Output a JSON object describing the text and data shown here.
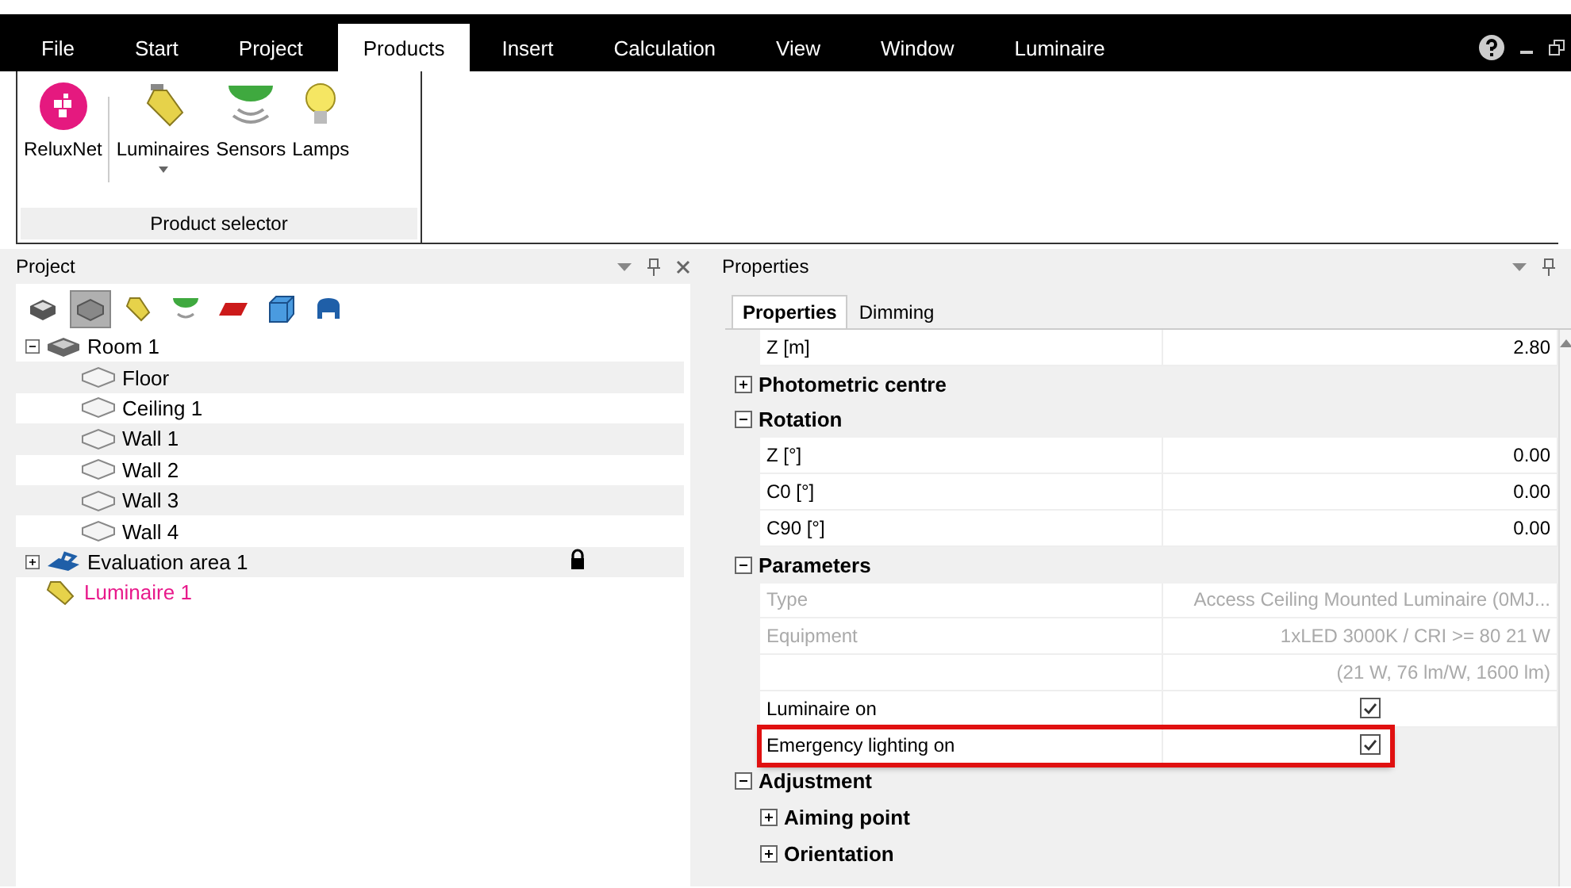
{
  "menu": [
    {
      "label": "File",
      "selected": false
    },
    {
      "label": "Start",
      "selected": false
    },
    {
      "label": "Project",
      "selected": false
    },
    {
      "label": "Products",
      "selected": true
    },
    {
      "label": "Insert",
      "selected": false
    },
    {
      "label": "Calculation",
      "selected": false
    },
    {
      "label": "View",
      "selected": false
    },
    {
      "label": "Window",
      "selected": false
    },
    {
      "label": "Luminaire",
      "selected": false
    }
  ],
  "ribbon": {
    "groups": [
      {
        "items": [
          {
            "kind": "reluxnet",
            "label": "ReluxNet",
            "dropdown": false
          }
        ]
      },
      {
        "items": [
          {
            "kind": "luminaire",
            "label": "Luminaires",
            "dropdown": true
          },
          {
            "kind": "sensor",
            "label": "Sensors",
            "dropdown": false
          },
          {
            "kind": "lamp",
            "label": "Lamps",
            "dropdown": false
          }
        ]
      }
    ],
    "group_label": "Product selector"
  },
  "project": {
    "title": "Project",
    "toolbar": [
      {
        "kind": "solid",
        "selected": false
      },
      {
        "kind": "wire",
        "selected": true
      },
      {
        "kind": "luminaire",
        "selected": false
      },
      {
        "kind": "sensor",
        "selected": false
      },
      {
        "kind": "plane",
        "selected": false
      },
      {
        "kind": "cube",
        "selected": false
      },
      {
        "kind": "chair",
        "selected": false
      }
    ],
    "tree": [
      {
        "label": "Room 1",
        "kind": "room",
        "expanded": true,
        "locked": false,
        "color": "#000000",
        "children": [
          {
            "label": "Floor",
            "kind": "surface",
            "locked": false,
            "color": "#000000"
          },
          {
            "label": "Ceiling 1",
            "kind": "surface",
            "locked": false,
            "color": "#000000"
          },
          {
            "label": "Wall 1",
            "kind": "surface",
            "locked": false,
            "color": "#000000"
          },
          {
            "label": "Wall 2",
            "kind": "surface",
            "locked": false,
            "color": "#000000"
          },
          {
            "label": "Wall 3",
            "kind": "surface",
            "locked": false,
            "color": "#000000"
          },
          {
            "label": "Wall 4",
            "kind": "surface",
            "locked": false,
            "color": "#000000"
          }
        ]
      },
      {
        "label": "Evaluation area 1",
        "kind": "evaluation",
        "expanded": false,
        "locked": true,
        "color": "#000000"
      },
      {
        "label": "Luminaire 1",
        "kind": "luminaire",
        "locked": false,
        "color": "#e8198b"
      }
    ]
  },
  "properties": {
    "title": "Properties",
    "tabs": [
      {
        "label": "Properties",
        "selected": true
      },
      {
        "label": "Dimming",
        "selected": false
      }
    ],
    "items": [
      {
        "kind": "row",
        "label": "Z [m]",
        "value": "2.80",
        "disabled": false
      },
      {
        "kind": "category",
        "label": "Photometric centre",
        "expanded": false
      },
      {
        "kind": "category",
        "label": "Rotation",
        "expanded": true,
        "children": [
          {
            "kind": "row",
            "label": "Z [°]",
            "value": "0.00",
            "disabled": false
          },
          {
            "kind": "row",
            "label": "C0 [°]",
            "value": "0.00",
            "disabled": false
          },
          {
            "kind": "row",
            "label": "C90 [°]",
            "value": "0.00",
            "disabled": false
          }
        ]
      },
      {
        "kind": "category",
        "label": "Parameters",
        "expanded": true,
        "children": [
          {
            "kind": "row",
            "label": "Type",
            "value": "Access Ceiling Mounted Luminaire (0MJ...",
            "disabled": true
          },
          {
            "kind": "row",
            "label": "Equipment",
            "value": "1xLED 3000K / CRI >= 80 21 W",
            "disabled": true
          },
          {
            "kind": "row",
            "value": "(21 W, 76 lm/W, 1600 lm)",
            "disabled": true
          },
          {
            "kind": "check",
            "label": "Luminaire on",
            "checked": true,
            "highlighted": false
          },
          {
            "kind": "check",
            "label": "Emergency lighting on",
            "checked": true,
            "highlighted": true
          }
        ]
      },
      {
        "kind": "category",
        "label": "Adjustment",
        "expanded": true,
        "children": [
          {
            "kind": "category",
            "label": "Aiming point",
            "expanded": false
          },
          {
            "kind": "category",
            "label": "Orientation",
            "expanded": false
          }
        ]
      }
    ]
  }
}
